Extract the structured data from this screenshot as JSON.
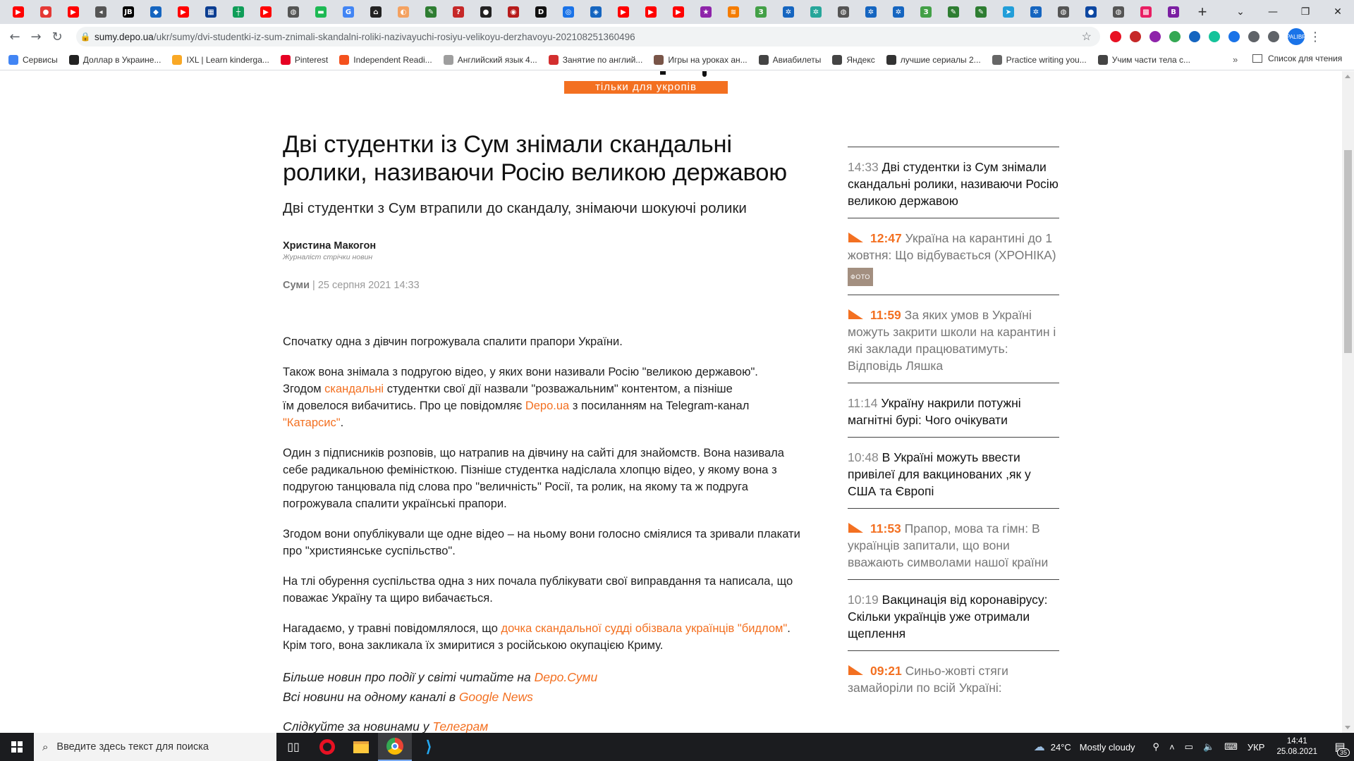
{
  "browser": {
    "tabs": [
      {
        "icon": "youtube-icon",
        "color": "#ff0000",
        "glyph": "▶"
      },
      {
        "icon": "dots-icon",
        "color": "#e53935",
        "glyph": "●"
      },
      {
        "icon": "youtube-icon",
        "color": "#ff0000",
        "glyph": "▶"
      },
      {
        "icon": "speaker-icon",
        "color": "#555555",
        "glyph": "◂"
      },
      {
        "icon": "jb-icon",
        "color": "#000000",
        "glyph": "JB"
      },
      {
        "icon": "pin-icon",
        "color": "#1565c0",
        "glyph": "◆"
      },
      {
        "icon": "youtube-icon",
        "color": "#ff0000",
        "glyph": "▶"
      },
      {
        "icon": "chart-icon",
        "color": "#0b3d91",
        "glyph": "▦"
      },
      {
        "icon": "sheet-icon",
        "color": "#0f9d58",
        "glyph": "┼"
      },
      {
        "icon": "youtube-icon",
        "color": "#ff0000",
        "glyph": "▶"
      },
      {
        "icon": "globe-icon",
        "color": "#555555",
        "glyph": "◍"
      },
      {
        "icon": "green-book-icon",
        "color": "#1db954",
        "glyph": "▬"
      },
      {
        "icon": "google-icon",
        "color": "#4285f4",
        "glyph": "G"
      },
      {
        "icon": "house-icon",
        "color": "#222222",
        "glyph": "⌂"
      },
      {
        "icon": "fox-icon",
        "color": "#f4a261",
        "glyph": "◐"
      },
      {
        "icon": "leaf-icon",
        "color": "#2e7d32",
        "glyph": "✎"
      },
      {
        "icon": "question-icon",
        "color": "#c62828",
        "glyph": "?"
      },
      {
        "icon": "github-icon",
        "color": "#222222",
        "glyph": "●"
      },
      {
        "icon": "avatar-icon",
        "color": "#b71c1c",
        "glyph": "◉"
      },
      {
        "icon": "depo-icon",
        "color": "#111111",
        "glyph": "D"
      },
      {
        "icon": "compass-icon",
        "color": "#1a73e8",
        "glyph": "◎"
      },
      {
        "icon": "badge-icon",
        "color": "#1565c0",
        "glyph": "◈"
      },
      {
        "icon": "youtube-icon",
        "color": "#ff0000",
        "glyph": "▶"
      },
      {
        "icon": "youtube-icon",
        "color": "#ff0000",
        "glyph": "▶"
      },
      {
        "icon": "youtube-icon",
        "color": "#ff0000",
        "glyph": "▶"
      },
      {
        "icon": "star-icon",
        "color": "#8e24aa",
        "glyph": "★"
      },
      {
        "icon": "wifi-icon",
        "color": "#f57c00",
        "glyph": "≋"
      },
      {
        "icon": "leaf-green-icon",
        "color": "#43a047",
        "glyph": "З"
      },
      {
        "icon": "gear-icon",
        "color": "#1565c0",
        "glyph": "✲"
      },
      {
        "icon": "gear-icon",
        "color": "#26a69a",
        "glyph": "✲"
      },
      {
        "icon": "globe-icon",
        "color": "#555555",
        "glyph": "◍"
      },
      {
        "icon": "gear-icon",
        "color": "#1565c0",
        "glyph": "✲"
      },
      {
        "icon": "gear-icon",
        "color": "#1565c0",
        "glyph": "✲"
      },
      {
        "icon": "leaf-green-icon",
        "color": "#43a047",
        "glyph": "З"
      },
      {
        "icon": "leaf-icon",
        "color": "#2e7d32",
        "glyph": "✎"
      },
      {
        "icon": "leaf-icon",
        "color": "#2e7d32",
        "glyph": "✎"
      },
      {
        "icon": "telegram-icon",
        "color": "#229ed9",
        "glyph": "➤"
      },
      {
        "icon": "gear-icon",
        "color": "#1565c0",
        "glyph": "✲"
      },
      {
        "icon": "globe-icon",
        "color": "#555555",
        "glyph": "◍"
      },
      {
        "icon": "moon-icon",
        "color": "#0d47a1",
        "glyph": "●"
      },
      {
        "icon": "globe-icon",
        "color": "#555555",
        "glyph": "◍"
      },
      {
        "icon": "multicolor-icon",
        "color": "#e91e63",
        "glyph": "▩"
      },
      {
        "icon": "bold-b-icon",
        "color": "#7b1fa2",
        "glyph": "B"
      }
    ],
    "url_host": "sumy.depo.ua",
    "url_path": "/ukr/sumy/dvi-studentki-iz-sum-znimali-skandalni-roliki-nazivayuchi-rosiyu-velikoyu-derzhavoyu-202108251360496",
    "extensions": [
      {
        "icon": "opera-ext-icon",
        "color": "#e81123"
      },
      {
        "icon": "video-ext-icon",
        "color": "#c62828"
      },
      {
        "icon": "shield-ext-icon",
        "color": "#8e24aa"
      },
      {
        "icon": "chat-ext-icon",
        "color": "#34a853"
      },
      {
        "icon": "new-ext-icon",
        "color": "#1565c0"
      },
      {
        "icon": "grammarly-ext-icon",
        "color": "#15c39a"
      },
      {
        "icon": "translate-ext-icon",
        "color": "#1a73e8"
      },
      {
        "icon": "puzzle-ext-icon",
        "color": "#5f6368"
      },
      {
        "icon": "playlist-ext-icon",
        "color": "#5f6368"
      }
    ],
    "profile_label": "PALIBR",
    "bookmarks": [
      {
        "label": "Сервисы",
        "color": "#4285f4"
      },
      {
        "label": "Доллар в Украине...",
        "color": "#222222"
      },
      {
        "label": "IXL | Learn kinderga...",
        "color": "#f9a825"
      },
      {
        "label": "Pinterest",
        "color": "#e60023"
      },
      {
        "label": "Independent Readi...",
        "color": "#f4511e"
      },
      {
        "label": "Английский язык 4...",
        "color": "#9e9e9e"
      },
      {
        "label": "Занятие по англий...",
        "color": "#d32f2f"
      },
      {
        "label": "Игры на уроках ан...",
        "color": "#795548"
      },
      {
        "label": "Авиабилеты",
        "color": "#444444"
      },
      {
        "label": "Яндекс",
        "color": "#444444"
      },
      {
        "label": "лучшие сериалы 2...",
        "color": "#333333"
      },
      {
        "label": "Practice writing you...",
        "color": "#666666"
      },
      {
        "label": "Учим части тела с...",
        "color": "#444444"
      }
    ],
    "bookmarks_more": "»",
    "reading_list": "Список для чтения"
  },
  "banner": {
    "text": "тільки для укропів"
  },
  "article": {
    "title": "Дві студентки із Сум знімали скандальні ролики, називаючи Росію великою державою",
    "subtitle": "Дві студентки з Сум втрапили до скандалу, знімаючи шокуючі ролики",
    "author": "Христина Макогон",
    "author_role": "Журналіст стрічки новин",
    "rubric": "Суми",
    "separator": "|",
    "date": "25 серпня 2021 14:33",
    "paragraphs": {
      "p1": "Спочатку одна з дівчин погрожувала спалити прапори України.",
      "p2a": "Також вона знімала з подругою відео, у яких вони називали Росію \"великою державою\".",
      "p2b": "Згодом ",
      "p2_link1": "скандальні",
      "p2c": " студентки свої дії назвали \"розважальним\" контентом, а пізніше",
      "p2d": "їм довелося вибачитись. Про це повідомляє ",
      "p2_link2": "Depo.ua",
      "p2e": " з посиланням на Telegram-канал",
      "p2_link3": "\"Катарсис\"",
      "p2f": ".",
      "p3": "Один з підписників розповів, що натрапив на дівчину на сайті для знайомств. Вона називала себе радикальною феміністкою. Пізніше студентка надіслала хлопцю відео, у якому вона з подругою танцювала під слова про \"величність\" Росії, та ролик, на якому та ж подруга погрожувала спалити українські прапори.",
      "p4": "Згодом вони опублікували ще одне відео – на ньому вони голосно сміялися та зривали плакати про \"християнське суспільство\".",
      "p5": "На тлі обурення суспільства одна з них почала публікувати свої виправдання та написала, що поважає Україну та щиро вибачається.",
      "p6a": "Нагадаємо, у травні повідомлялося, що ",
      "p6_link": "дочка скандальної судді обізвала українців \"бидлом\"",
      "p6b": ".",
      "p6c": "Крім того, вона закликала їх змиритися з російською окупацією Криму."
    },
    "more": {
      "line1": "Більше новин про події у світі читайте на ",
      "line1_link": "Depo.Суми",
      "line2": "Всі новини на одному каналі в ",
      "line2_link": "Google News",
      "line3": "Слідкуйте за новинами у ",
      "line3_link": "Телеграм"
    }
  },
  "sidebar": {
    "news": [
      {
        "time": "14:33",
        "title": "Дві студентки із Сум знімали скандальні ролики, називаючи Росію великою державою",
        "hot": false,
        "badge": ""
      },
      {
        "time": "12:47",
        "title": "Україна на карантині до 1 жовтня: Що відбувається (ХРОНІКА)",
        "hot": true,
        "badge": "ФОТО"
      },
      {
        "time": "11:59",
        "title": "За яких умов в Україні можуть закрити школи на карантин і які заклади працюватимуть: Відповідь Ляшка",
        "hot": true,
        "badge": ""
      },
      {
        "time": "11:14",
        "title": "Україну накрили потужні магнітні бурі: Чого очікувати",
        "hot": false,
        "badge": ""
      },
      {
        "time": "10:48",
        "title": "В Україні можуть ввести привілеї для вакцинованих ,як у США та Європі",
        "hot": false,
        "badge": ""
      },
      {
        "time": "11:53",
        "title": "Прапор, мова та гімн: В українців запитали, що вони вважають символами нашої країни",
        "hot": true,
        "badge": ""
      },
      {
        "time": "10:19",
        "title": "Вакцинація від коронавірусу: Скільки українців уже отримали щеплення",
        "hot": false,
        "badge": ""
      },
      {
        "time": "09:21",
        "title": "Синьо-жовті стяги замайоріли по всій Україні:",
        "hot": true,
        "badge": ""
      }
    ],
    "accent": "#f37021"
  },
  "taskbar": {
    "search_placeholder": "Введите здесь текст для поиска",
    "apps": [
      {
        "icon": "task-view-icon",
        "active": false
      },
      {
        "icon": "opera-icon",
        "active": false
      },
      {
        "icon": "file-explorer-icon",
        "active": false
      },
      {
        "icon": "chrome-icon",
        "active": true
      },
      {
        "icon": "vscode-icon",
        "active": false
      }
    ],
    "weather_temp": "24°C",
    "weather_text": "Mostly cloudy",
    "lang": "УКР",
    "time": "14:41",
    "date": "25.08.2021",
    "notif_count": "35"
  }
}
